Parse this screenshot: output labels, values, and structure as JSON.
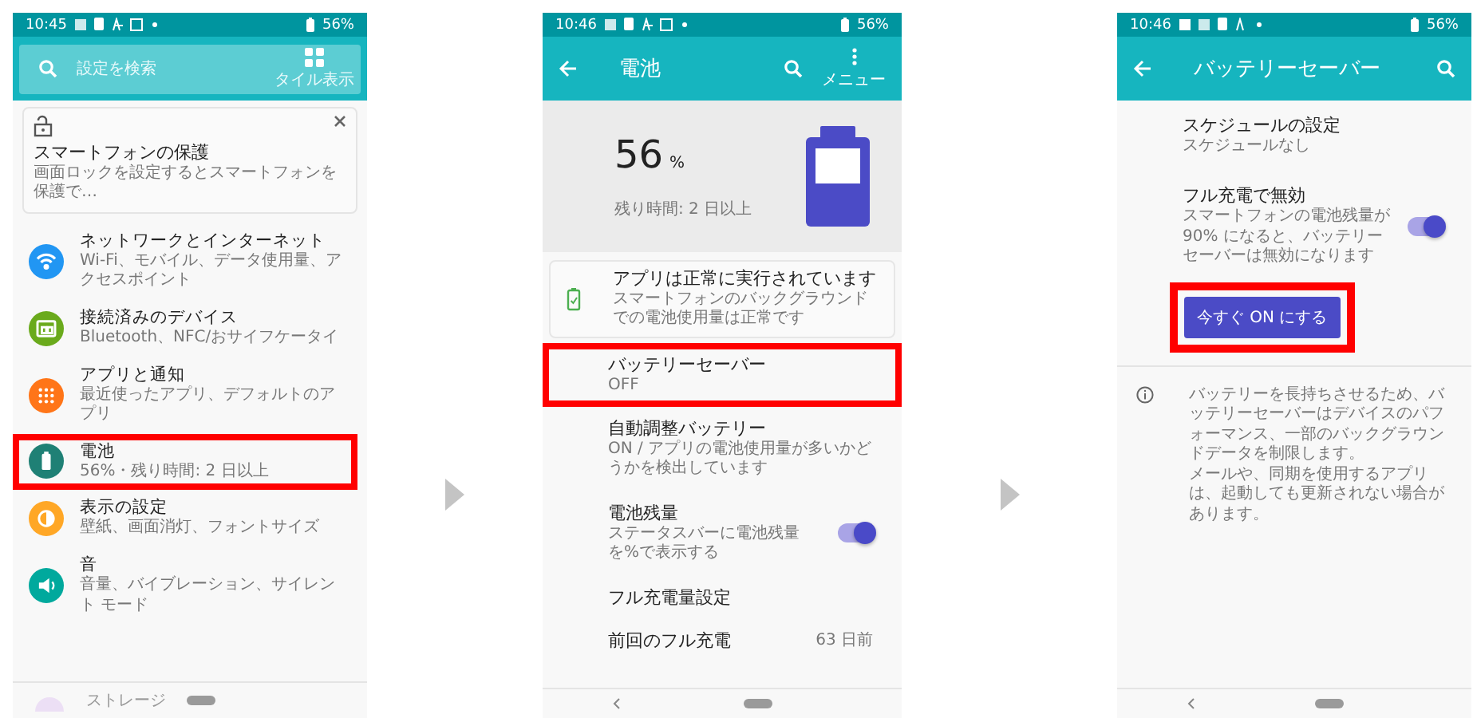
{
  "settings_screen": {
    "status_bar": {
      "time": "10:45",
      "battery": "56%"
    },
    "search": {
      "placeholder": "設定を検索",
      "view_button": "タイル表示"
    },
    "tip_card": {
      "title": "スマートフォンの保護",
      "subtitle": "画面ロックを設定するとスマートフォンを保護で…"
    },
    "items": [
      {
        "title": "ネットワークとインターネット",
        "subtitle": "Wi-Fi、モバイル、データ使用量、アクセスポイント",
        "color": "#2196f3",
        "highlighted": false
      },
      {
        "title": "接続済みのデバイス",
        "subtitle": "Bluetooth、NFC/おサイフケータイ",
        "color": "#6aaa1c",
        "highlighted": false
      },
      {
        "title": "アプリと通知",
        "subtitle": "最近使ったアプリ、デフォルトのアプリ",
        "color": "#ff7518",
        "highlighted": false
      },
      {
        "title": "電池",
        "subtitle": "56%・残り時間: 2 日以上",
        "color": "#1f8075",
        "highlighted": true
      },
      {
        "title": "表示の設定",
        "subtitle": "壁紙、画面消灯、フォントサイズ",
        "color": "#ffa726",
        "highlighted": false
      },
      {
        "title": "音",
        "subtitle": "音量、バイブレーション、サイレント モード",
        "color": "#00a99d",
        "highlighted": false
      }
    ],
    "peek_item": "ストレージ"
  },
  "battery_screen": {
    "status_bar": {
      "time": "10:46",
      "battery": "56%"
    },
    "title": "電池",
    "menu_label": "メニュー",
    "percent": "56",
    "percent_unit": "%",
    "remaining": "残り時間: 2 日以上",
    "level": 0.56,
    "status_card": {
      "title": "アプリは正常に実行されています",
      "subtitle": "スマートフォンのバックグラウンドでの電池使用量は正常です"
    },
    "items": [
      {
        "kind": "text",
        "title": "バッテリーセーバー",
        "subtitle": "OFF",
        "highlighted": true
      },
      {
        "kind": "text",
        "title": "自動調整バッテリー",
        "subtitle": "ON / アプリの電池使用量が多いかどうかを検出しています",
        "highlighted": false
      },
      {
        "kind": "toggle",
        "title": "電池残量",
        "subtitle": "ステータスバーに電池残量を%で表示する",
        "on": true,
        "highlighted": false
      },
      {
        "kind": "text",
        "title": "フル充電量設定",
        "highlighted": false
      },
      {
        "kind": "value",
        "title": "前回のフル充電",
        "value": "63 日前",
        "highlighted": false
      }
    ]
  },
  "battery_saver_screen": {
    "status_bar": {
      "time": "10:46",
      "battery": "56%"
    },
    "title": "バッテリーセーバー",
    "schedule": {
      "title": "スケジュールの設定",
      "subtitle": "スケジュールなし"
    },
    "full_charge": {
      "title": "フル充電で無効",
      "subtitle": "スマートフォンの電池残量が90% になると、バッテリーセーバーは無効になります",
      "on": true
    },
    "start_button": {
      "label": "今すぐ ON にする",
      "highlighted": true
    },
    "info": [
      "バッテリーを長持ちさせるため、バッテリーセーバーはデバイスのパフォーマンス、一部のバックグラウンドデータを制限します。",
      "メールや、同期を使用するアプリは、起動しても更新されない場合があります。"
    ]
  }
}
